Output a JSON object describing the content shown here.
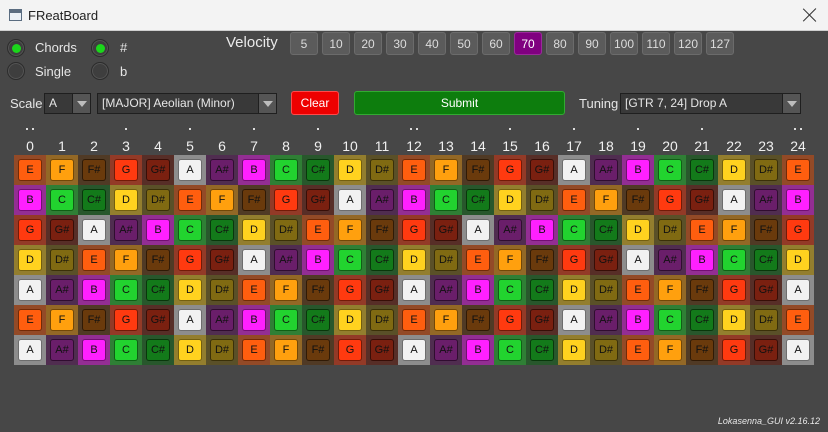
{
  "window": {
    "title": "FReatBoard"
  },
  "mode": {
    "chords_label": "Chords",
    "chords_selected": true,
    "single_label": "Single",
    "single_selected": false,
    "sharp_label": "#",
    "sharp_selected": true,
    "flat_label": "b",
    "flat_selected": false
  },
  "velocity": {
    "label": "Velocity",
    "options": [
      "5",
      "10",
      "20",
      "30",
      "40",
      "50",
      "60",
      "70",
      "80",
      "90",
      "100",
      "110",
      "120",
      "127"
    ],
    "selected": "70"
  },
  "scale": {
    "label": "Scale",
    "root": "A",
    "mode": "[MAJOR] Aeolian (Minor)"
  },
  "buttons": {
    "clear": "Clear",
    "submit": "Submit"
  },
  "tuning": {
    "label": "Tuning",
    "value": "[GTR 7, 24] Drop A"
  },
  "fret_numbers": [
    "0",
    "1",
    "2",
    "3",
    "4",
    "5",
    "6",
    "7",
    "8",
    "9",
    "10",
    "11",
    "12",
    "13",
    "14",
    "15",
    "16",
    "17",
    "18",
    "19",
    "20",
    "21",
    "22",
    "23",
    "24"
  ],
  "fret_markers": {
    "single": [
      3,
      5,
      7,
      9,
      15,
      17,
      19,
      21
    ],
    "double": [
      0,
      12,
      24
    ]
  },
  "strings": [
    [
      "E",
      "F",
      "F#",
      "G",
      "G#",
      "A",
      "A#",
      "B",
      "C",
      "C#",
      "D",
      "D#",
      "E",
      "F",
      "F#",
      "G",
      "G#",
      "A",
      "A#",
      "B",
      "C",
      "C#",
      "D",
      "D#",
      "E"
    ],
    [
      "B",
      "C",
      "C#",
      "D",
      "D#",
      "E",
      "F",
      "F#",
      "G",
      "G#",
      "A",
      "A#",
      "B",
      "C",
      "C#",
      "D",
      "D#",
      "E",
      "F",
      "F#",
      "G",
      "G#",
      "A",
      "A#",
      "B"
    ],
    [
      "G",
      "G#",
      "A",
      "A#",
      "B",
      "C",
      "C#",
      "D",
      "D#",
      "E",
      "F",
      "F#",
      "G",
      "G#",
      "A",
      "A#",
      "B",
      "C",
      "C#",
      "D",
      "D#",
      "E",
      "F",
      "F#",
      "G"
    ],
    [
      "D",
      "D#",
      "E",
      "F",
      "F#",
      "G",
      "G#",
      "A",
      "A#",
      "B",
      "C",
      "C#",
      "D",
      "D#",
      "E",
      "F",
      "F#",
      "G",
      "G#",
      "A",
      "A#",
      "B",
      "C",
      "C#",
      "D"
    ],
    [
      "A",
      "A#",
      "B",
      "C",
      "C#",
      "D",
      "D#",
      "E",
      "F",
      "F#",
      "G",
      "G#",
      "A",
      "A#",
      "B",
      "C",
      "C#",
      "D",
      "D#",
      "E",
      "F",
      "F#",
      "G",
      "G#",
      "A"
    ],
    [
      "E",
      "F",
      "F#",
      "G",
      "G#",
      "A",
      "A#",
      "B",
      "C",
      "C#",
      "D",
      "D#",
      "E",
      "F",
      "F#",
      "G",
      "G#",
      "A",
      "A#",
      "B",
      "C",
      "C#",
      "D",
      "D#",
      "E"
    ],
    [
      "A",
      "A#",
      "B",
      "C",
      "C#",
      "D",
      "D#",
      "E",
      "F",
      "F#",
      "G",
      "G#",
      "A",
      "A#",
      "B",
      "C",
      "C#",
      "D",
      "D#",
      "E",
      "F",
      "F#",
      "G",
      "G#",
      "A"
    ]
  ],
  "note_colors": {
    "C": "#22d32f",
    "C#": "#137a1a",
    "D": "#ffd21f",
    "D#": "#806a12",
    "E": "#ff5e0f",
    "F": "#ffa00e",
    "F#": "#6a3a0c",
    "G": "#ff3a10",
    "G#": "#7a2010",
    "A": "#f2f2f2",
    "A#": "#6a1e6a",
    "B": "#ff20ff"
  },
  "version": "Lokasenna_GUI v2.16.12"
}
